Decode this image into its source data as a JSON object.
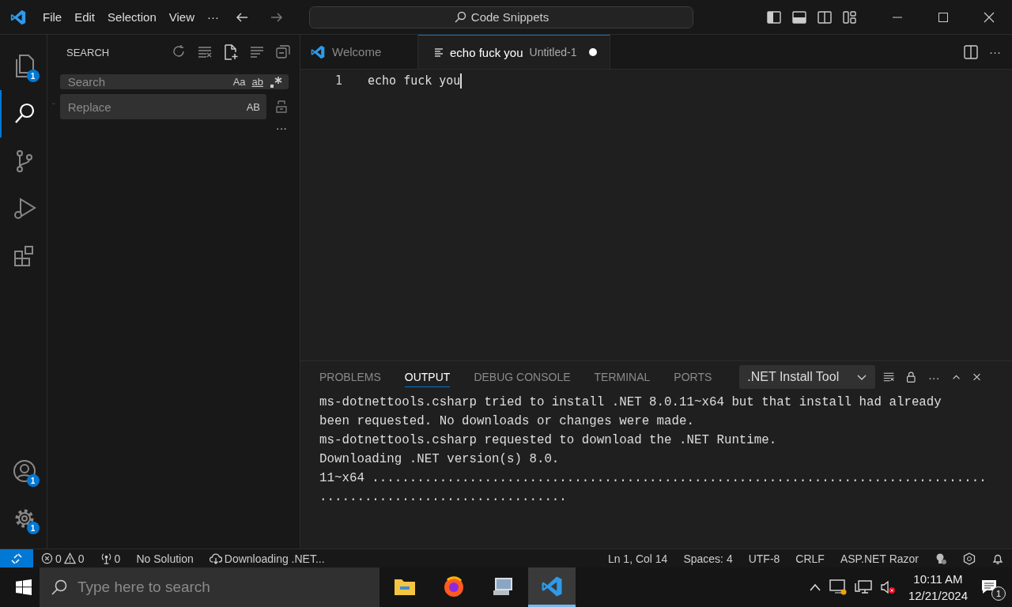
{
  "title_bar": {
    "menu": [
      "File",
      "Edit",
      "Selection",
      "View"
    ],
    "more": "···",
    "command_center": "Code Snippets"
  },
  "activity_bar": [
    {
      "kind": "explorer",
      "badge": "1",
      "selected": false
    },
    {
      "kind": "search",
      "selected": true
    },
    {
      "kind": "source-control",
      "selected": false
    },
    {
      "kind": "run",
      "selected": false
    },
    {
      "kind": "extensions",
      "selected": false
    },
    {
      "kind": "accounts",
      "badge": "1",
      "selected": false
    },
    {
      "kind": "manage",
      "badge": "1",
      "selected": false
    }
  ],
  "sidebar": {
    "title": "SEARCH",
    "search": {
      "placeholder": "Search",
      "match_case": "Aa",
      "whole_word": "ab"
    },
    "replace": {
      "placeholder": "Replace",
      "preserve_case": "AB"
    },
    "more": "···"
  },
  "editor": {
    "tabs": [
      {
        "kind": "welcome",
        "label": "Welcome",
        "selected": false,
        "dirty": false
      },
      {
        "kind": "file",
        "label": "echo fuck you",
        "description": "Untitled-1",
        "selected": true,
        "dirty": true
      }
    ],
    "lines": [
      {
        "number": "1",
        "text": "echo fuck you"
      }
    ],
    "more": "···"
  },
  "panel": {
    "tabs": [
      {
        "label": "PROBLEMS",
        "selected": false
      },
      {
        "label": "OUTPUT",
        "selected": true
      },
      {
        "label": "DEBUG CONSOLE",
        "selected": false
      },
      {
        "label": "TERMINAL",
        "selected": false
      },
      {
        "label": "PORTS",
        "selected": false
      }
    ],
    "channel": ".NET Install Tool",
    "more": "···",
    "output": [
      "ms-dotnettools.csharp tried to install .NET 8.0.11~x64 but that install had already",
      "been requested. No downloads or changes were made.",
      "ms-dotnettools.csharp requested to download the .NET Runtime.",
      "Downloading .NET version(s) 8.0.",
      "11~x64 ..................................................................................",
      "................................."
    ]
  },
  "status_bar": {
    "errors": "0",
    "warnings": "0",
    "ports": "0",
    "solution": "No Solution",
    "progress": "Downloading .NET...",
    "right": [
      "Ln 1, Col 14",
      "Spaces: 4",
      "UTF-8",
      "CRLF",
      "ASP.NET Razor"
    ]
  },
  "taskbar": {
    "search_placeholder": "Type here to search",
    "apps": [
      {
        "kind": "files",
        "selected": false
      },
      {
        "kind": "firefox",
        "selected": false
      },
      {
        "kind": "computer",
        "selected": false
      },
      {
        "kind": "vscode",
        "selected": true
      }
    ],
    "time": "10:11 AM",
    "date": "12/21/2024",
    "notifications": "1"
  }
}
